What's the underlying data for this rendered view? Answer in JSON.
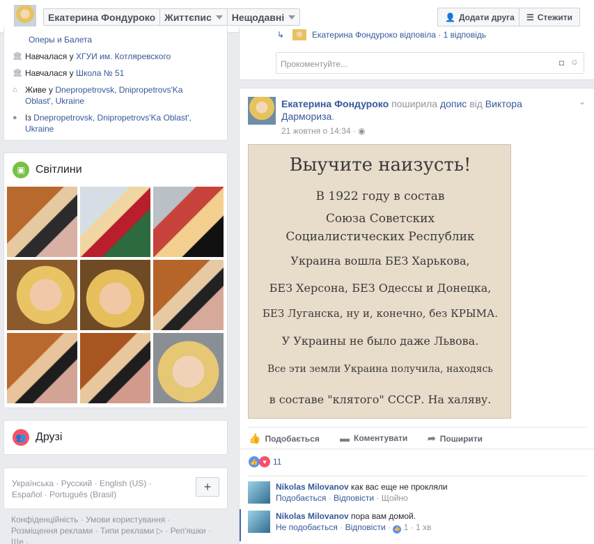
{
  "header": {
    "name": "Екатерина Фондуроко",
    "tab_timeline": "Життєпис",
    "tab_recent": "Нещодавні",
    "add_friend": "Додати друга",
    "follow": "Стежити"
  },
  "about": {
    "partial_top": "Оперы и Балета",
    "rows": [
      {
        "prefix": "Навчалася у ",
        "link": "ХГУИ им. Котляревского"
      },
      {
        "prefix": "Навчалася у ",
        "link": "Школа № 51"
      },
      {
        "prefix": "Живе у ",
        "link": "Dnepropetrovsk, Dnipropetrovs'Ka Oblast', Ukraine"
      },
      {
        "prefix": "Із ",
        "link": "Dnepropetrovsk, Dnipropetrovs'Ka Oblast', Ukraine"
      }
    ]
  },
  "photos": {
    "title": "Світлини"
  },
  "friends": {
    "title": "Друзі"
  },
  "languages": {
    "line1": "Українська · Русский · English (US) ·",
    "line2": "Español · Português (Brasil)",
    "add": "+"
  },
  "footer": {
    "line1": "Конфіденційність · Умови користування ·",
    "line2": "Розміщення реклами · Типи реклами ▷ · Реп'яшки ·",
    "line3": "Ще ·"
  },
  "prev_post": {
    "reply_text": "Екатерина Фондуроко відповіла · 1 відповідь",
    "comment_placeholder": "Прокоментуйте..."
  },
  "post": {
    "author": "Екатерина Фондуроко",
    "shared": "поширила",
    "post_link": "допис",
    "from": "від",
    "original_author": "Виктора Дармориза",
    "time": "21 жовтня о 14:34 ·",
    "image_lines": [
      "Выучите наизусть!",
      "В 1922 году в состав",
      "Союза Советских",
      "Социалистических Республик",
      "Украина вошла БЕЗ Харькова,",
      "БЕЗ Херсона, БЕЗ Одессы и Донецка,",
      "БЕЗ Луганска, ну и, конечно, без КРЫМА.",
      "У Украины не было даже Львова.",
      "Все эти земли Украина получила, находясь",
      "в составе \"клятого\" СССР. На халяву."
    ],
    "like": "Подобається",
    "comment": "Коментувати",
    "share": "Поширити",
    "reactions_count": "11"
  },
  "comments": [
    {
      "author": "Nikolas Milovanov",
      "text": "как вас еще не прокляли",
      "like": "Подобається",
      "reply": "Відповісти",
      "time": "Щойно"
    },
    {
      "author": "Nikolas Milovanov",
      "text": "пора вам домой.",
      "unlike": "Не подобається",
      "reply": "Відповісти",
      "likes": "1",
      "time": "1 хв"
    }
  ]
}
